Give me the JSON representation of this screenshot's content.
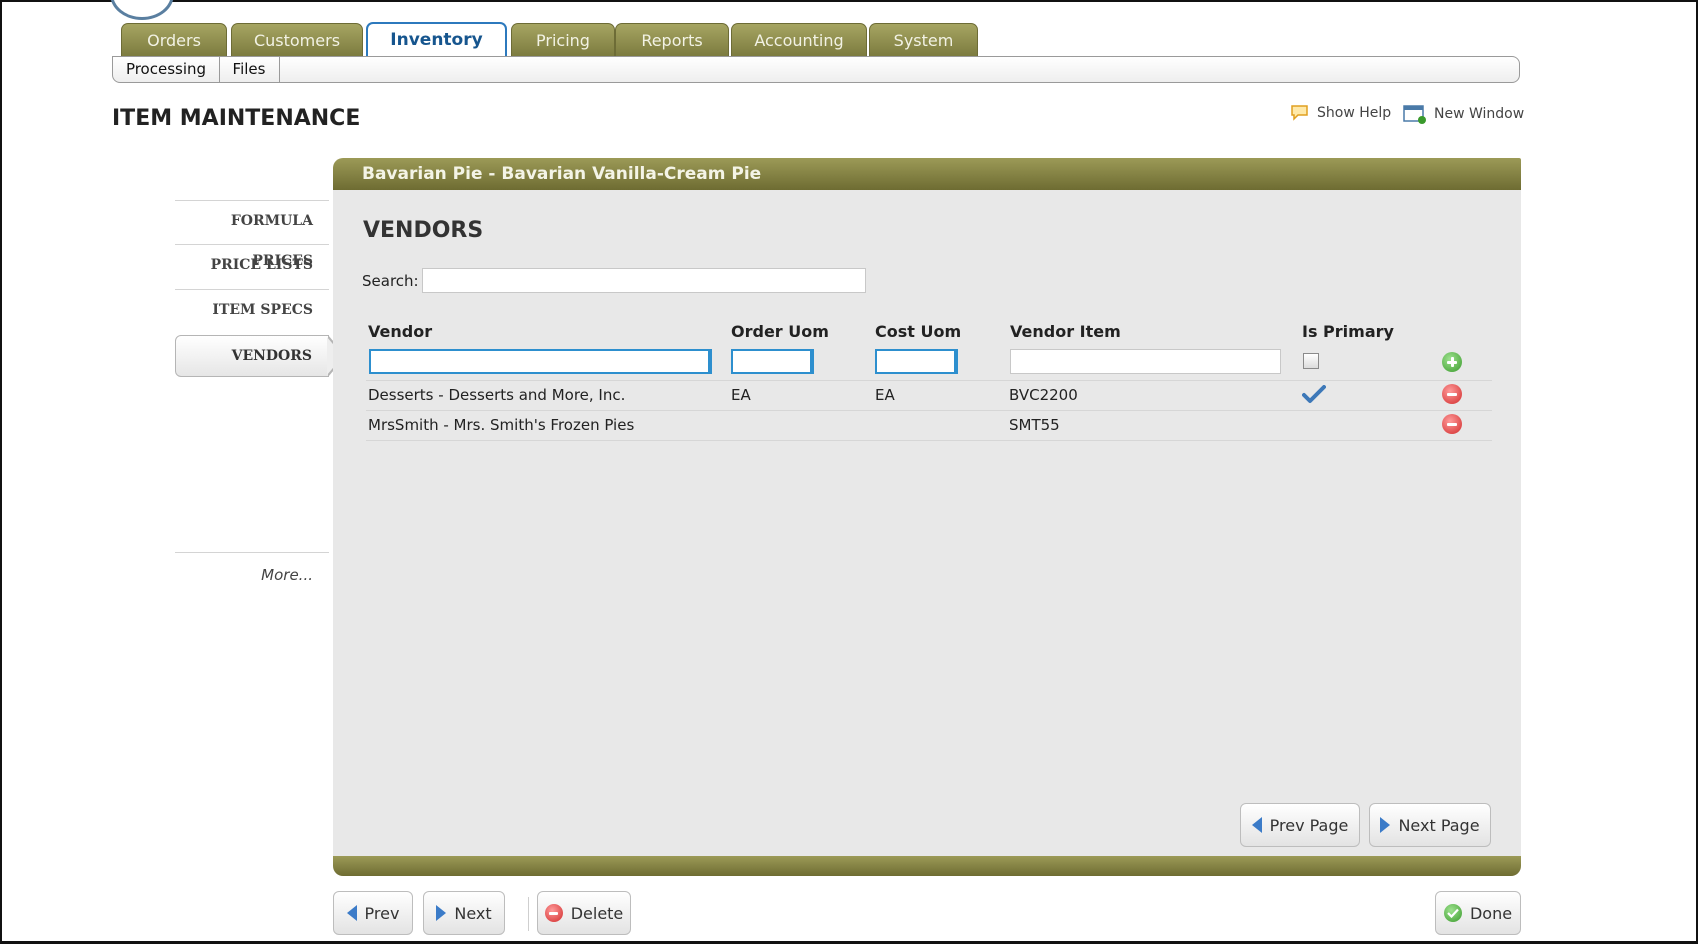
{
  "nav": {
    "tabs": [
      {
        "label": "Orders",
        "active": false
      },
      {
        "label": "Customers",
        "active": false
      },
      {
        "label": "Inventory",
        "active": true
      },
      {
        "label": "Pricing",
        "active": false
      },
      {
        "label": "Reports",
        "active": false
      },
      {
        "label": "Accounting",
        "active": false
      },
      {
        "label": "System",
        "active": false
      }
    ],
    "subtabs": [
      "Processing",
      "Files"
    ]
  },
  "page": {
    "title": "ITEM MAINTENANCE",
    "show_help": "Show Help",
    "new_window": "New Window"
  },
  "sidebar": {
    "items": [
      {
        "label": "FORMULA PRICES",
        "selected": false
      },
      {
        "label": "PRICE LISTS",
        "selected": false
      },
      {
        "label": "ITEM SPECS",
        "selected": false
      },
      {
        "label": "VENDORS",
        "selected": true
      }
    ],
    "more": "More..."
  },
  "panel": {
    "header": "Bavarian Pie - Bavarian Vanilla-Cream Pie",
    "section_title": "VENDORS",
    "search_label": "Search:",
    "search_value": "",
    "columns": [
      "Vendor",
      "Order Uom",
      "Cost Uom",
      "Vendor Item",
      "Is Primary"
    ],
    "rows": [
      {
        "vendor": "Desserts - Desserts and More, Inc.",
        "order_uom": "EA",
        "cost_uom": "EA",
        "vendor_item": "BVC2200",
        "is_primary": true
      },
      {
        "vendor": "MrsSmith - Mrs. Smith's Frozen Pies",
        "order_uom": "",
        "cost_uom": "",
        "vendor_item": "SMT55",
        "is_primary": false
      }
    ],
    "prev_page": "Prev Page",
    "next_page": "Next Page"
  },
  "footer": {
    "prev": "Prev",
    "next": "Next",
    "delete": "Delete",
    "done": "Done"
  },
  "colors": {
    "olive": "#8a8948",
    "accent_blue": "#2c79bd",
    "add_green": "#3a9a2c",
    "delete_red": "#d12b2b"
  }
}
